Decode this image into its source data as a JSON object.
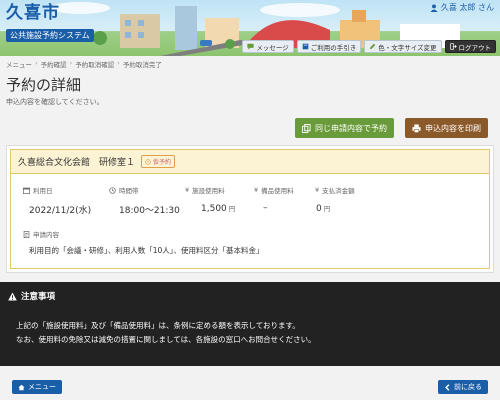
{
  "header": {
    "logo_main": "久喜市",
    "logo_sub": "公共施設予約システム",
    "user": "久喜 太郎 さん",
    "buttons": {
      "message": "メッセージ",
      "guide": "ご利用の手引き",
      "display": "色・文字サイズ変更",
      "logout": "ログアウト"
    }
  },
  "breadcrumb": [
    "メニュー",
    "予約確認",
    "予約取消確認",
    "予約取消完了"
  ],
  "page": {
    "title": "予約の詳細",
    "subtitle": "申込内容を確認してください。"
  },
  "actions": {
    "reapply": "同じ申請内容で予約",
    "print": "申込内容を印刷"
  },
  "reservation": {
    "facility": "久喜総合文化会館　研修室１",
    "tag": "仮予約",
    "labels": {
      "date": "利用日",
      "time": "時間帯",
      "facility_fee": "施設使用料",
      "equipment_fee": "備品使用料",
      "amount_due": "支払済金額",
      "request": "申請内容"
    },
    "values": {
      "date": "2022/11/2(水)",
      "time": "18:00～21:30",
      "facility_fee": "1,500",
      "equipment_fee": "–",
      "amount_due": "0",
      "yen": "円",
      "yen2": "円",
      "request": "利用目的「会議・研修」、利用人数「10人」、使用料区分「基本料金」"
    }
  },
  "notice": {
    "title": "注意事項",
    "line1": "上記の「施設使用料」及び「備品使用料」は、条例に定める額を表示しております。",
    "line2": "なお、使用料の免除又は減免の措置に関しましては、各施設の窓口へお問合せください。"
  },
  "footer": {
    "menu": "メニュー",
    "back": "前に戻る"
  },
  "colors": {
    "brand": "#1b5ea8",
    "green": "#6a9b3a",
    "brown": "#8b5a2b",
    "notice_bg": "#222222",
    "card_head": "#fbf3d4"
  }
}
